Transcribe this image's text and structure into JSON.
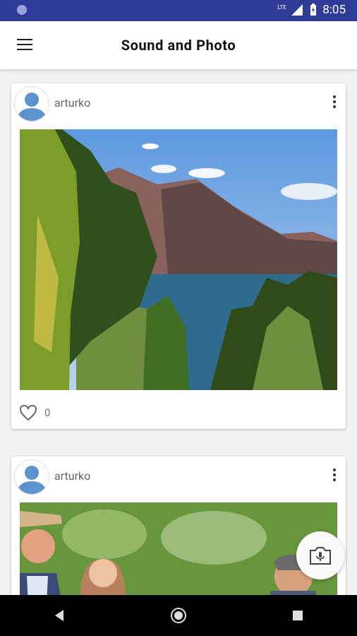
{
  "status_bar": {
    "time": "8:05",
    "network": "LTE"
  },
  "app_bar": {
    "title": "Sound and Photo",
    "menu_icon": "hamburger-menu-icon"
  },
  "posts": [
    {
      "username": "arturko",
      "likes": "0",
      "photo_description": ""
    },
    {
      "username": "arturko",
      "likes": "",
      "photo_description": ""
    }
  ],
  "fab": {
    "icon": "camera-audio-icon"
  },
  "nav": {
    "back": "back-icon",
    "home": "home-icon",
    "recents": "recents-icon"
  },
  "colors": {
    "status_bar": "#2f3c97",
    "avatar": "#5d93cc"
  }
}
